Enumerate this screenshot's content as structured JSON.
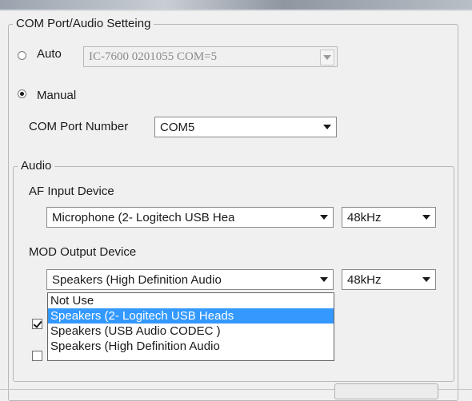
{
  "com_group": {
    "title": "COM Port/Audio Setteing",
    "auto": {
      "label": "Auto",
      "selected": false,
      "value": "IC-7600 0201055 COM=5"
    },
    "manual": {
      "label": "Manual",
      "selected": true
    },
    "com_port": {
      "label": "COM Port Number",
      "value": "COM5"
    }
  },
  "audio_group": {
    "title": "Audio",
    "af_input": {
      "label": "AF Input Device",
      "device_value": "Microphone (2- Logitech USB Hea",
      "rate_value": "48kHz"
    },
    "mod_output": {
      "label": "MOD Output Device",
      "device_value": "Speakers (High Definition Audio",
      "rate_value": "48kHz",
      "options": [
        "Not Use",
        "Speakers (2- Logitech USB Heads",
        "Speakers (USB Audio CODEC )",
        "Speakers (High Definition Audio"
      ],
      "highlighted_index": 1
    },
    "checkbox_1_checked": true,
    "checkbox_2_checked": false
  }
}
